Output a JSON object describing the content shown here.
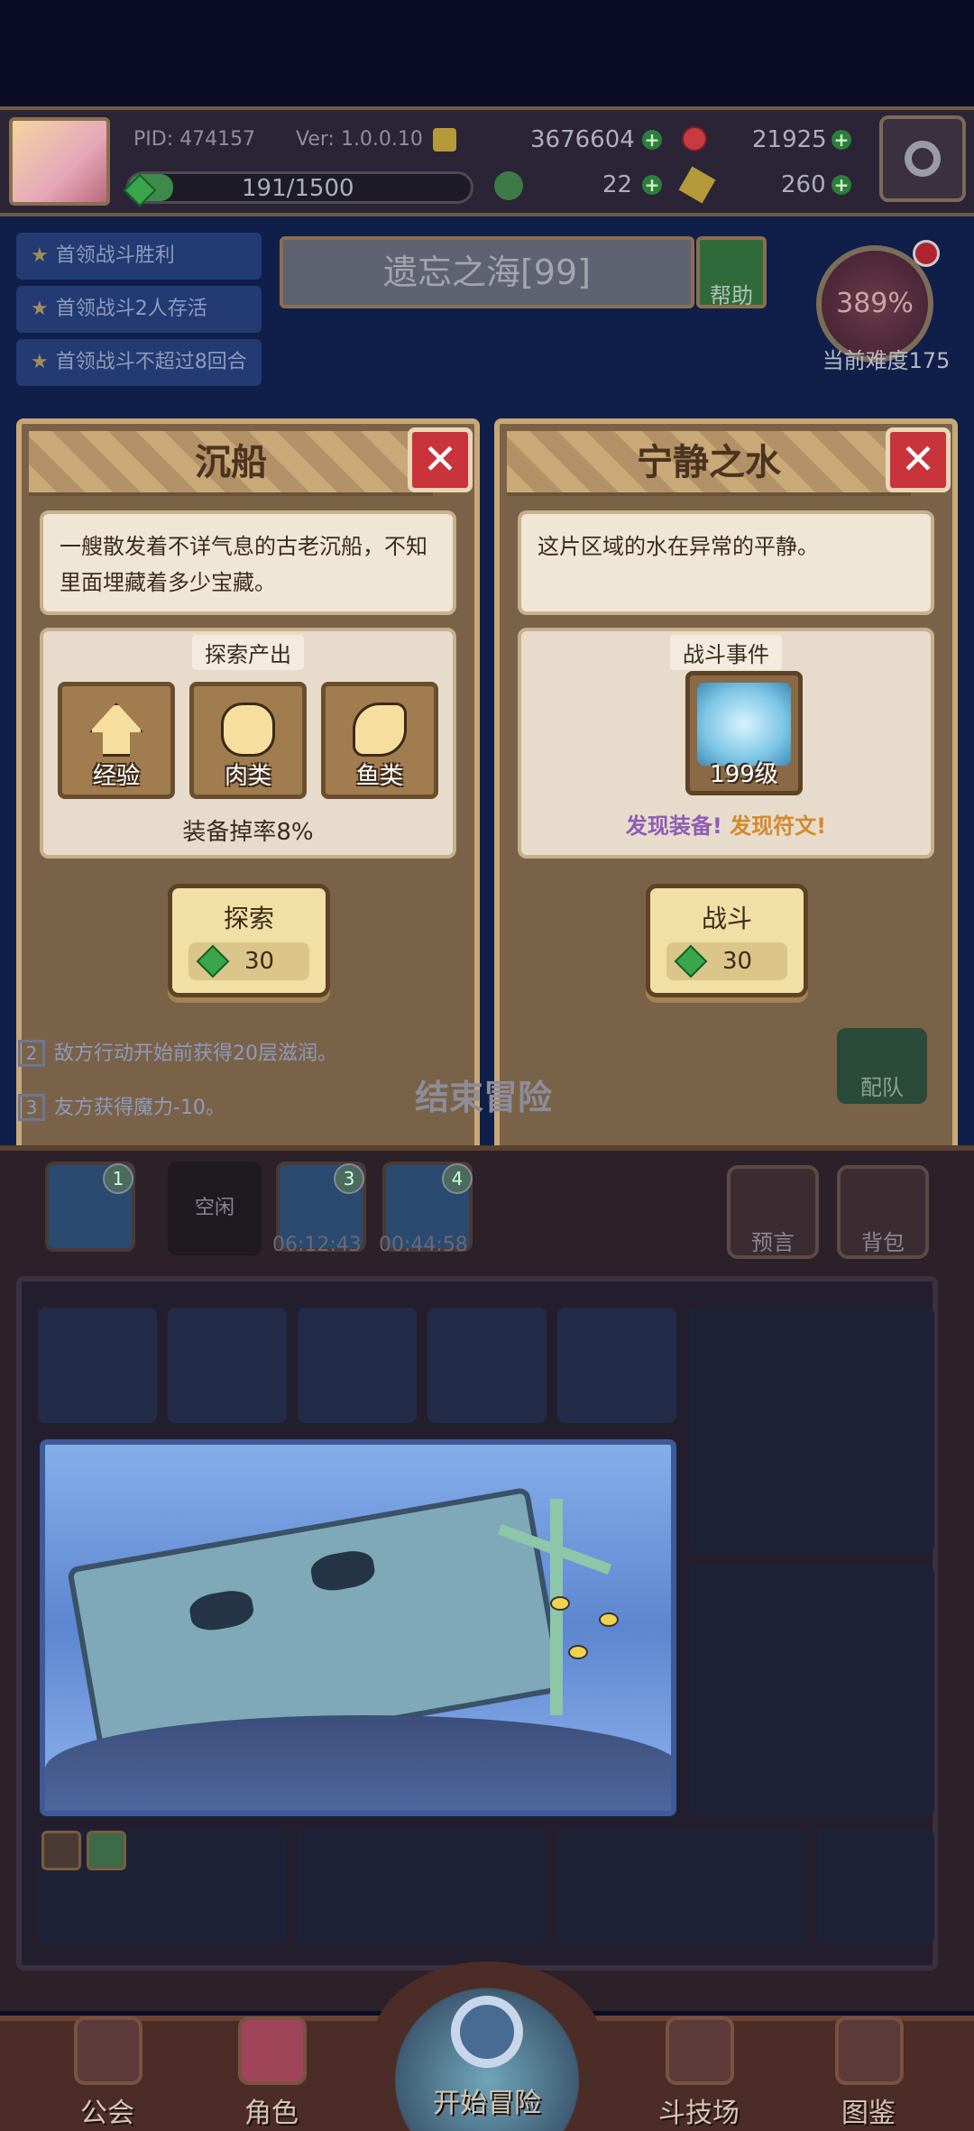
{
  "hud": {
    "pid": "PID: 474157",
    "version": "Ver: 1.0.0.10",
    "gold": "3676604",
    "ruby": "21925",
    "exp": "191/1500",
    "clover": "22",
    "keys": "260"
  },
  "missions": [
    "首领战斗胜利",
    "首领战斗2人存活",
    "首领战斗不超过8回合"
  ],
  "stage": {
    "title": "遗忘之海[99]",
    "help": "帮助",
    "difficulty_percent": "389%",
    "difficulty_label": "当前难度175"
  },
  "card_left": {
    "title": "沉船",
    "close": "✕",
    "description": "一艘散发着不详气息的古老沉船，不知里面埋藏着多少宝藏。",
    "section": "探索产出",
    "outputs": [
      "经验",
      "肉类",
      "鱼类"
    ],
    "drop_rate": "装备掉率8%",
    "button_label": "探索",
    "cost": "30"
  },
  "card_right": {
    "title": "宁静之水",
    "close": "✕",
    "description": "这片区域的水在异常的平静。",
    "section": "战斗事件",
    "boss_level": "199级",
    "found_equipment": "发现装备!",
    "found_rune": "发现符文!",
    "button_label": "战斗",
    "cost": "30"
  },
  "behind": {
    "line2_num": "2",
    "line2": "敌方行动开始前获得20层滋润。",
    "line3_num": "3",
    "line3": "友方获得魔力-10。",
    "end_adventure": "结束冒险",
    "team": "配队"
  },
  "slots": {
    "badge1": "1",
    "idle": "空闲",
    "badge3": "3",
    "badge4": "4",
    "timer3": "06:12:43",
    "timer4": "00:44:58",
    "prophecy": "预言",
    "bag": "背包"
  },
  "nav": {
    "guild": "公会",
    "character": "角色",
    "start": "开始冒险",
    "arena": "斗技场",
    "codex": "图鉴"
  },
  "colors": {
    "accent_red": "#c9333b",
    "parchment": "#f0e6d6",
    "found_equipment": "#8f5bb5",
    "found_rune": "#d3892c"
  }
}
